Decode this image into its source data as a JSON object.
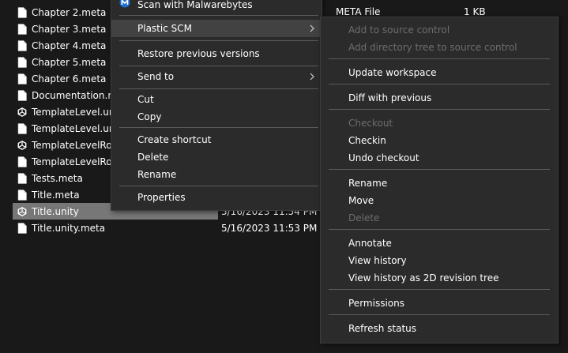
{
  "files": [
    {
      "name": "Chapter 2.meta",
      "icon": "file-icon"
    },
    {
      "name": "Chapter 3.meta",
      "icon": "file-icon"
    },
    {
      "name": "Chapter 4.meta",
      "icon": "file-icon"
    },
    {
      "name": "Chapter 5.meta",
      "icon": "file-icon"
    },
    {
      "name": "Chapter 6.meta",
      "icon": "file-icon"
    },
    {
      "name": "Documentation.meta",
      "icon": "file-icon"
    },
    {
      "name": "TemplateLevel.unity",
      "icon": "unity-icon"
    },
    {
      "name": "TemplateLevel.unity.meta",
      "icon": "file-icon"
    },
    {
      "name": "TemplateLevelRoom.unity",
      "icon": "unity-icon"
    },
    {
      "name": "TemplateLevelRoom.unity.meta",
      "icon": "file-icon"
    },
    {
      "name": "Tests.meta",
      "icon": "file-icon"
    },
    {
      "name": "Title.meta",
      "icon": "file-icon"
    },
    {
      "name": "Title.unity",
      "icon": "unity-icon",
      "date": "5/16/2023 11:54 PM",
      "selected": true
    },
    {
      "name": "Title.unity.meta",
      "icon": "file-icon",
      "date": "5/16/2023 11:53 PM"
    }
  ],
  "details": {
    "type": "META File",
    "size": "1 KB"
  },
  "context_menu": {
    "scan": "Scan with Malwarebytes",
    "plastic": "Plastic SCM",
    "restore": "Restore previous versions",
    "send_to": "Send to",
    "cut": "Cut",
    "copy": "Copy",
    "create_shortcut": "Create shortcut",
    "delete": "Delete",
    "rename": "Rename",
    "properties": "Properties"
  },
  "plastic_menu": {
    "add_source": "Add to source control",
    "add_tree": "Add directory tree to source control",
    "update": "Update workspace",
    "diff": "Diff with previous",
    "checkout": "Checkout",
    "checkin": "Checkin",
    "undo_checkout": "Undo checkout",
    "rename": "Rename",
    "move": "Move",
    "delete": "Delete",
    "annotate": "Annotate",
    "view_history": "View history",
    "view_history_2d": "View history as 2D revision tree",
    "permissions": "Permissions",
    "refresh": "Refresh status"
  }
}
